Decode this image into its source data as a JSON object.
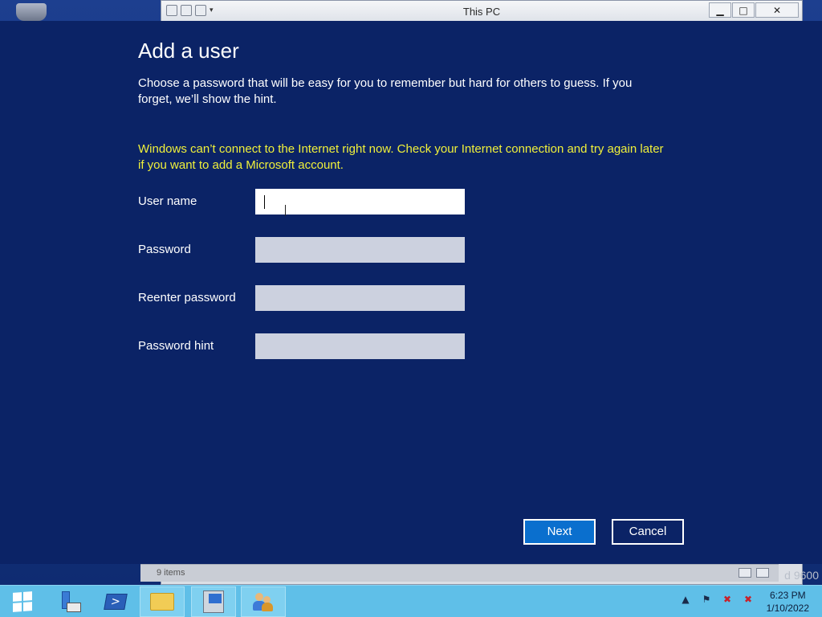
{
  "explorer": {
    "title": "This PC",
    "status": "9 items",
    "win_controls": {
      "minimize": "▁",
      "maximize": "□",
      "close": "✕"
    }
  },
  "watermark": "d 9600",
  "dialog": {
    "title": "Add a user",
    "description": "Choose a password that will be easy for you to remember but hard for others to guess. If you forget, we’ll show the hint.",
    "warning": "Windows can’t connect to the Internet right now. Check your Internet connection and try again later if you want to add a Microsoft account.",
    "fields": [
      {
        "label": "User name",
        "value": "",
        "placeholder": ""
      },
      {
        "label": "Password",
        "value": "",
        "placeholder": ""
      },
      {
        "label": "Reenter password",
        "value": "",
        "placeholder": ""
      },
      {
        "label": "Password hint",
        "value": "",
        "placeholder": ""
      }
    ],
    "next_label": "Next",
    "cancel_label": "Cancel"
  },
  "taskbar": {
    "items": [
      "start-button",
      "server-manager",
      "powershell",
      "file-explorer",
      "setup",
      "users"
    ],
    "clock_time": "6:23 PM",
    "clock_date": "1/10/2022",
    "tray": {
      "arrow": "▲",
      "flag": "⚑",
      "network": "✖",
      "volume": "✖"
    }
  },
  "colors": {
    "dialog_bg": "#0b2366",
    "warning_text": "#f0f03a",
    "primary_button": "#0a6fce",
    "taskbar": "#5fbfe8"
  }
}
